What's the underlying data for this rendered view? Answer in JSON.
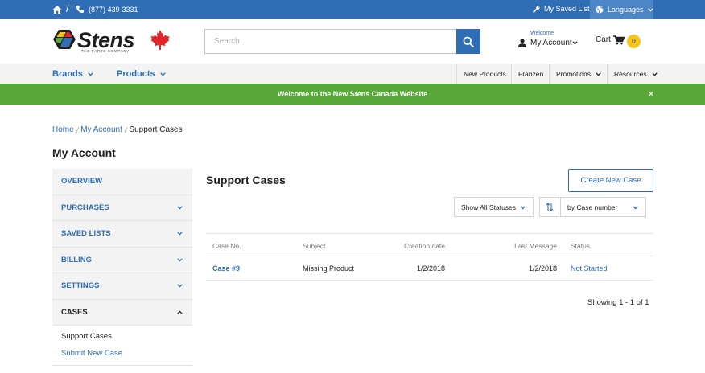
{
  "topbar": {
    "phone": "(877) 439-3331",
    "saved_lists": "My Saved Lists",
    "languages": "Languages"
  },
  "header": {
    "logo_text": "Stens",
    "logo_tagline": "THE PARTS COMPANY",
    "search_placeholder": "Search",
    "welcome": "Welcome",
    "my_account": "My Account",
    "cart_label": "Cart",
    "cart_count": "0"
  },
  "nav": {
    "brands": "Brands",
    "products": "Products",
    "new_products": "New Products",
    "franzen": "Franzen",
    "promotions": "Promotions",
    "resources": "Resources"
  },
  "banner": {
    "message": "Welcome to the New Stens Canada Website",
    "close": "×"
  },
  "breadcrumb": {
    "home": "Home",
    "account": "My Account",
    "current": "Support Cases"
  },
  "page_title": "My Account",
  "sidebar": {
    "items": [
      {
        "label": "OVERVIEW"
      },
      {
        "label": "PURCHASES"
      },
      {
        "label": "SAVED LISTS"
      },
      {
        "label": "BILLING"
      },
      {
        "label": "SETTINGS"
      },
      {
        "label": "CASES"
      }
    ],
    "sub": {
      "support_cases": "Support Cases",
      "submit_new_case": "Submit New Case"
    }
  },
  "main": {
    "title": "Support Cases",
    "create_button": "Create New Case",
    "status_filter": "Show All Statuses",
    "sort_by": "by Case number",
    "columns": {
      "case_no": "Case No.",
      "subject": "Subject",
      "creation_date": "Creation date",
      "last_message": "Last Message",
      "status": "Status"
    },
    "rows": [
      {
        "case_no": "Case #9",
        "subject": "Missing Product",
        "creation_date": "1/2/2018",
        "last_message": "1/2/2018",
        "status": "Not Started"
      }
    ],
    "showing": "Showing 1 - 1 of 1"
  },
  "colors": {
    "primary_blue": "#2f6db5",
    "banner_green": "#59a839",
    "cart_badge": "#f5c518",
    "logo_red": "#e3262b"
  }
}
